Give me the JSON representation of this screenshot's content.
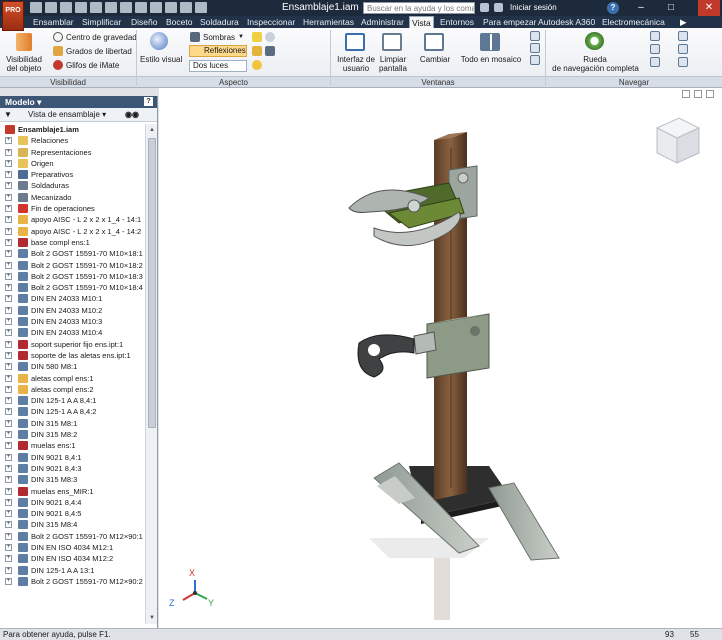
{
  "app": {
    "logo_text": "PRO",
    "document_title": "Ensamblaje1.iam"
  },
  "titlebar": {
    "search_placeholder": "Buscar en la ayuda y los comandos...",
    "signin_label": "Iniciar sesión",
    "help_label": "?"
  },
  "tabs": [
    {
      "label": "Ensamblar"
    },
    {
      "label": "Simplificar"
    },
    {
      "label": "Diseño"
    },
    {
      "label": "Boceto"
    },
    {
      "label": "Soldadura"
    },
    {
      "label": "Inspeccionar"
    },
    {
      "label": "Herramientas"
    },
    {
      "label": "Administrar"
    },
    {
      "label": "Vista"
    },
    {
      "label": "Entornos"
    },
    {
      "label": "Para empezar"
    },
    {
      "label": "Autodesk A360"
    },
    {
      "label": "Electromecánica"
    }
  ],
  "active_tab": "Vista",
  "ribbon": {
    "visibility": {
      "object_label_1": "Visibilidad",
      "object_label_2": "del objeto",
      "gravity": "Centro de gravedad",
      "dof": "Grados de libertad",
      "imate": "Glifos de iMate",
      "group": "Visibilidad"
    },
    "appearance": {
      "visual_style": "Estilo visual",
      "shadows": "Sombras",
      "reflections": "Reflexiones",
      "lights": "Dos luces",
      "group": "Aspecto"
    },
    "windows": {
      "ui_1": "Interfaz de",
      "ui_2": "usuario",
      "clean_1": "Limpiar",
      "clean_2": "pantalla",
      "switch": "Cambiar",
      "tile": "Todo en mosaico",
      "group": "Ventanas"
    },
    "navigate": {
      "wheel_1": "Rueda",
      "wheel_2": "de navegación completa",
      "group": "Navegar"
    }
  },
  "browser": {
    "title": "Modelo",
    "view_label": "Vista de ensamblaje",
    "root": "Ensamblaje1.iam",
    "items": [
      {
        "label": "Relaciones",
        "icon": "folder-icon",
        "color": "#e8c25a"
      },
      {
        "label": "Representaciones",
        "icon": "representations-icon",
        "color": "#d9b457"
      },
      {
        "label": "Origen",
        "icon": "folder-icon",
        "color": "#e8c25a"
      },
      {
        "label": "Preparativos",
        "icon": "preparations-icon",
        "color": "#4c6b95"
      },
      {
        "label": "Soldaduras",
        "icon": "welds-icon",
        "color": "#6c7c8e"
      },
      {
        "label": "Mecanizado",
        "icon": "machining-icon",
        "color": "#6c7c8e"
      },
      {
        "label": "Fin de operaciones",
        "icon": "end-of-features-icon",
        "color": "#d0362d"
      },
      {
        "label": "apoyo AISC - L 2 x 2 x 1_4 - 14:1",
        "icon": "subassembly-icon",
        "color": "#e8b448"
      },
      {
        "label": "apoyo AISC - L 2 x 2 x 1_4 - 14:2",
        "icon": "subassembly-icon",
        "color": "#e8b448"
      },
      {
        "label": "base compl ens:1",
        "icon": "subassembly-icon",
        "color": "#b02a30"
      },
      {
        "label": "Bolt 2 GOST 15591-70 M10×18:1",
        "icon": "part-icon",
        "color": "#5f7ea6"
      },
      {
        "label": "Bolt 2 GOST 15591-70 M10×18:2",
        "icon": "part-icon",
        "color": "#5f7ea6"
      },
      {
        "label": "Bolt 2 GOST 15591-70 M10×18:3",
        "icon": "part-icon",
        "color": "#5f7ea6"
      },
      {
        "label": "Bolt 2 GOST 15591-70 M10×18:4",
        "icon": "part-icon",
        "color": "#5f7ea6"
      },
      {
        "label": "DIN EN 24033 M10:1",
        "icon": "part-icon",
        "color": "#5f7ea6"
      },
      {
        "label": "DIN EN 24033 M10:2",
        "icon": "part-icon",
        "color": "#5f7ea6"
      },
      {
        "label": "DIN EN 24033 M10:3",
        "icon": "part-icon",
        "color": "#5f7ea6"
      },
      {
        "label": "DIN EN 24033 M10:4",
        "icon": "part-icon",
        "color": "#5f7ea6"
      },
      {
        "label": "soport superior fijo ens.ipt:1",
        "icon": "subassembly-icon",
        "color": "#b02a30"
      },
      {
        "label": "soporte de las aletas ens.ipt:1",
        "icon": "subassembly-icon",
        "color": "#b02a30"
      },
      {
        "label": "DIN 580 M8:1",
        "icon": "part-icon",
        "color": "#5f7ea6"
      },
      {
        "label": "aletas compl ens:1",
        "icon": "subassembly-icon",
        "color": "#e8b448"
      },
      {
        "label": "aletas compl ens:2",
        "icon": "subassembly-icon",
        "color": "#e8b448"
      },
      {
        "label": "DIN 125-1 A A 8,4:1",
        "icon": "part-icon",
        "color": "#5f7ea6"
      },
      {
        "label": "DIN 125-1 A A 8,4:2",
        "icon": "part-icon",
        "color": "#5f7ea6"
      },
      {
        "label": "DIN 315 M8:1",
        "icon": "part-icon",
        "color": "#5f7ea6"
      },
      {
        "label": "DIN 315 M8:2",
        "icon": "part-icon",
        "color": "#5f7ea6"
      },
      {
        "label": "muelas ens:1",
        "icon": "subassembly-icon",
        "color": "#b02a30"
      },
      {
        "label": "DIN 9021 8,4:1",
        "icon": "part-icon",
        "color": "#5f7ea6"
      },
      {
        "label": "DIN 9021 8,4:3",
        "icon": "part-icon",
        "color": "#5f7ea6"
      },
      {
        "label": "DIN 315 M8:3",
        "icon": "part-icon",
        "color": "#5f7ea6"
      },
      {
        "label": "muelas ens_MIR:1",
        "icon": "subassembly-icon",
        "color": "#b02a30"
      },
      {
        "label": "DIN 9021 8,4:4",
        "icon": "part-icon",
        "color": "#5f7ea6"
      },
      {
        "label": "DIN 9021 8,4:5",
        "icon": "part-icon",
        "color": "#5f7ea6"
      },
      {
        "label": "DIN 315 M8:4",
        "icon": "part-icon",
        "color": "#5f7ea6"
      },
      {
        "label": "Bolt 2 GOST 15591-70 M12×90:1",
        "icon": "part-icon",
        "color": "#5f7ea6"
      },
      {
        "label": "DIN EN ISO 4034 M12:1",
        "icon": "part-icon",
        "color": "#5f7ea6"
      },
      {
        "label": "DIN EN ISO 4034 M12:2",
        "icon": "part-icon",
        "color": "#5f7ea6"
      },
      {
        "label": "DIN 125-1 A A 13:1",
        "icon": "part-icon",
        "color": "#5f7ea6"
      },
      {
        "label": "Bolt 2 GOST 15591-70 M12×90:2",
        "icon": "part-icon",
        "color": "#5f7ea6"
      }
    ]
  },
  "viewport": {
    "axis_z": "Z",
    "axis_x": "X",
    "axis_y": "Y",
    "viewcube_icon": "viewcube-icon"
  },
  "status": {
    "message": "Para obtener ayuda, pulse F1.",
    "count_1": "93",
    "count_2": "55"
  }
}
